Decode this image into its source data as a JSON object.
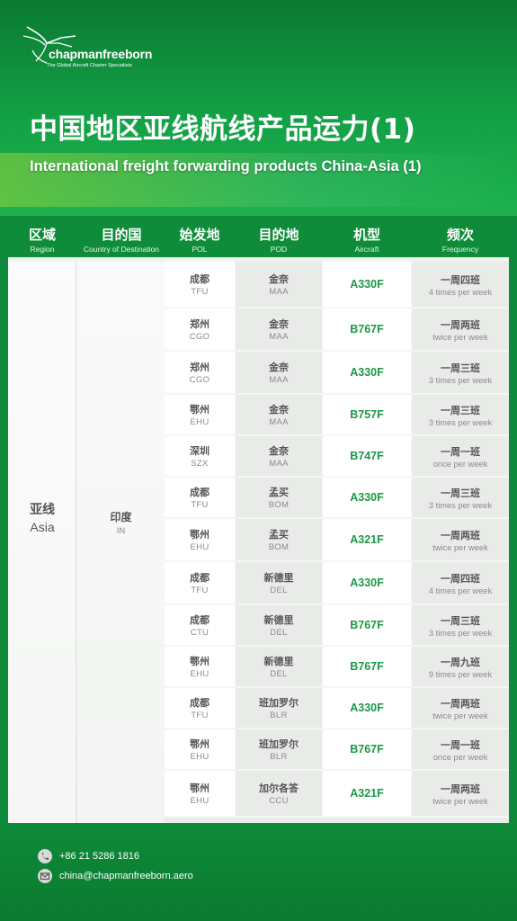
{
  "brand": {
    "name": "chapmanfreeborn",
    "tagline": "The Global Aircraft Charter Specialists"
  },
  "title": {
    "cn": "中国地区亚线航线产品运力(1)",
    "en": "International freight forwarding products China-Asia (1)"
  },
  "headers": [
    {
      "cn": "区域",
      "en": "Region"
    },
    {
      "cn": "目的国",
      "en": "Country of Destination"
    },
    {
      "cn": "始发地",
      "en": "POL"
    },
    {
      "cn": "目的地",
      "en": "POD"
    },
    {
      "cn": "机型",
      "en": "Aircraft"
    },
    {
      "cn": "频次",
      "en": "Frequency"
    }
  ],
  "region": {
    "cn": "亚线",
    "en": "Asia"
  },
  "country": {
    "cn": "印度",
    "en": "IN"
  },
  "rows": [
    {
      "pol_cn": "成都",
      "pol_en": "TFU",
      "pod_cn": "金奈",
      "pod_en": "MAA",
      "aircraft": "A330F",
      "freq_cn": "一周四班",
      "freq_en": "4 times per week"
    },
    {
      "pol_cn": "郑州",
      "pol_en": "CGO",
      "pod_cn": "金奈",
      "pod_en": "MAA",
      "aircraft": "B767F",
      "freq_cn": "一周两班",
      "freq_en": "twice per week"
    },
    {
      "pol_cn": "郑州",
      "pol_en": "CGO",
      "pod_cn": "金奈",
      "pod_en": "MAA",
      "aircraft": "A330F",
      "freq_cn": "一周三班",
      "freq_en": "3 times per week"
    },
    {
      "pol_cn": "鄂州",
      "pol_en": "EHU",
      "pod_cn": "金奈",
      "pod_en": "MAA",
      "aircraft": "B757F",
      "freq_cn": "一周三班",
      "freq_en": "3 times per week"
    },
    {
      "pol_cn": "深圳",
      "pol_en": "SZX",
      "pod_cn": "金奈",
      "pod_en": "MAA",
      "aircraft": "B747F",
      "freq_cn": "一周一班",
      "freq_en": "once per week"
    },
    {
      "pol_cn": "成都",
      "pol_en": "TFU",
      "pod_cn": "孟买",
      "pod_en": "BOM",
      "aircraft": "A330F",
      "freq_cn": "一周三班",
      "freq_en": "3 times per week"
    },
    {
      "pol_cn": "鄂州",
      "pol_en": "EHU",
      "pod_cn": "孟买",
      "pod_en": "BOM",
      "aircraft": "A321F",
      "freq_cn": "一周两班",
      "freq_en": "twice per week"
    },
    {
      "pol_cn": "成都",
      "pol_en": "TFU",
      "pod_cn": "新德里",
      "pod_en": "DEL",
      "aircraft": "A330F",
      "freq_cn": "一周四班",
      "freq_en": "4 times per week"
    },
    {
      "pol_cn": "成都",
      "pol_en": "CTU",
      "pod_cn": "新德里",
      "pod_en": "DEL",
      "aircraft": "B767F",
      "freq_cn": "一周三班",
      "freq_en": "3 times per week"
    },
    {
      "pol_cn": "鄂州",
      "pol_en": "EHU",
      "pod_cn": "新德里",
      "pod_en": "DEL",
      "aircraft": "B767F",
      "freq_cn": "一周九班",
      "freq_en": "9 times per week"
    },
    {
      "pol_cn": "成都",
      "pol_en": "TFU",
      "pod_cn": "班加罗尔",
      "pod_en": "BLR",
      "aircraft": "A330F",
      "freq_cn": "一周两班",
      "freq_en": "twice per week"
    },
    {
      "pol_cn": "鄂州",
      "pol_en": "EHU",
      "pod_cn": "班加罗尔",
      "pod_en": "BLR",
      "aircraft": "B767F",
      "freq_cn": "一周一班",
      "freq_en": "once per week"
    },
    {
      "pol_cn": "鄂州",
      "pol_en": "EHU",
      "pod_cn": "加尔各答",
      "pod_en": "CCU",
      "aircraft": "A321F",
      "freq_cn": "一周两班",
      "freq_en": "twice per week"
    }
  ],
  "contact": {
    "phone": "+86 21 5286 1816",
    "email": "china@chapmanfreeborn.aero",
    "phone_icon": "phone-icon",
    "email_icon": "mail-icon"
  },
  "colors": {
    "brand_green": "#0e8c3a",
    "aircraft_text": "#1a9a45"
  }
}
